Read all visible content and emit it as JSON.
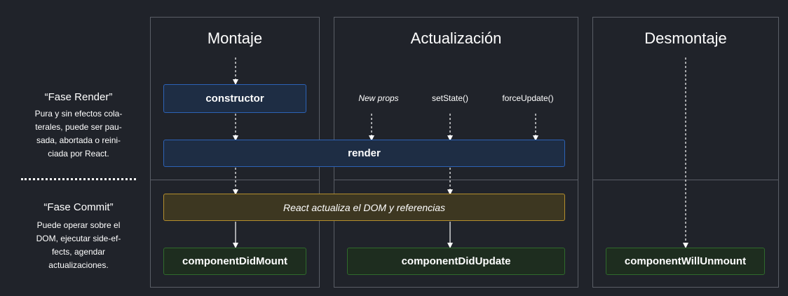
{
  "phases": {
    "render": {
      "title": "“Fase Render”",
      "lines": [
        "Pura y sin efectos cola-",
        "terales, puede ser pau-",
        "sada, abortada o reini-",
        "ciada por React."
      ]
    },
    "commit": {
      "title": "“Fase Commit”",
      "lines": [
        "Puede operar sobre el",
        "DOM, ejecutar side-ef-",
        "fects, agendar",
        "actualizaciones."
      ]
    }
  },
  "columns": {
    "mounting": {
      "title": "Montaje"
    },
    "updating": {
      "title": "Actualización"
    },
    "unmounting": {
      "title": "Desmontaje"
    }
  },
  "triggers": {
    "new_props": "New props",
    "set_state": "setState()",
    "force_update": "forceUpdate()"
  },
  "boxes": {
    "constructor": "constructor",
    "render": "render",
    "dom_update": "React actualiza el DOM y referencias",
    "did_mount": "componentDidMount",
    "did_update": "componentDidUpdate",
    "will_unmount": "componentWillUnmount"
  },
  "colors": {
    "background": "#20232a",
    "render_phase_box": "#1e2d44",
    "render_phase_border": "#2c62b6",
    "commit_box": "#3d3721",
    "commit_border": "#b48e2d",
    "lifecycle_box": "#1e2d1f",
    "lifecycle_border": "#2f6a2c"
  }
}
